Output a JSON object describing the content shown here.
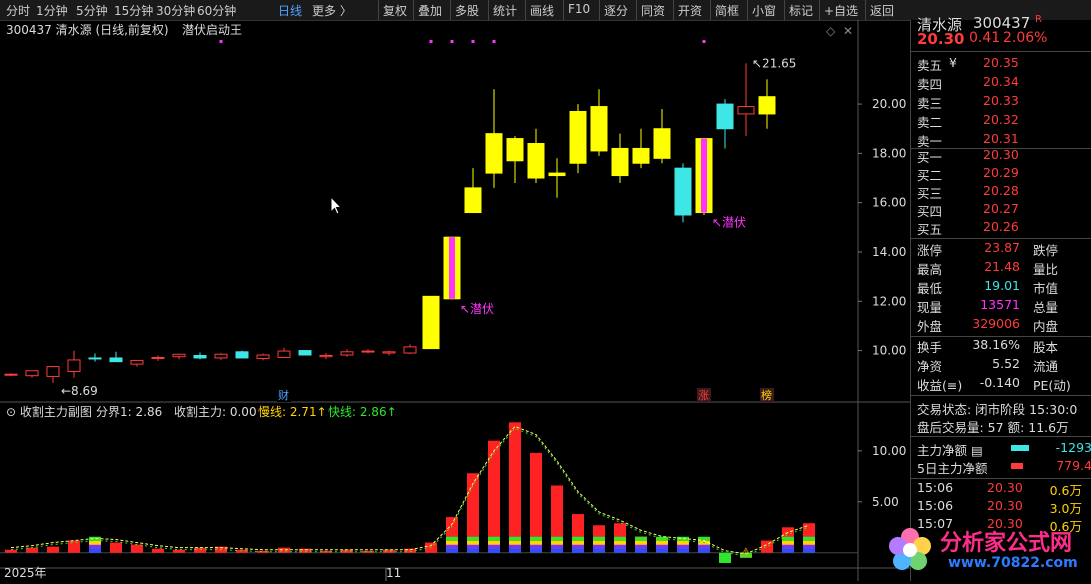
{
  "toolbar": {
    "period_items": [
      "分时",
      "1分钟",
      "5分钟",
      "15分钟",
      "30分钟",
      "60分钟",
      "日线",
      "更多 〉"
    ],
    "active_period": "日线",
    "buttons": [
      "复权",
      "叠加",
      "多股",
      "统计",
      "画线",
      "F10",
      "逐分",
      "同资",
      "开资",
      "简框",
      "小窗",
      "标记",
      "+自选",
      "返回"
    ]
  },
  "chart_header": {
    "code_name": "300437  清水源 (日线,前复权)",
    "indicator_name": "潜伏启动王"
  },
  "chart_data": [
    {
      "type": "candlestick",
      "title": "300437 清水源 (日线,前复权)",
      "indicator": "潜伏启动王",
      "y_ticks": [
        "20.00",
        "18.00",
        "16.00",
        "14.00",
        "12.00",
        "10.00"
      ],
      "ylim": [
        8.4,
        22.6
      ],
      "candles": [
        {
          "o": 9.0,
          "h": 9.08,
          "l": 8.96,
          "c": 9.04
        },
        {
          "o": 8.98,
          "h": 9.1,
          "l": 8.9,
          "c": 9.18
        },
        {
          "o": 8.95,
          "h": 9.3,
          "l": 8.69,
          "c": 9.35
        },
        {
          "o": 9.15,
          "h": 10.0,
          "l": 8.9,
          "c": 9.62
        },
        {
          "o": 9.7,
          "h": 9.88,
          "l": 9.55,
          "c": 9.68
        },
        {
          "o": 9.7,
          "h": 9.95,
          "l": 9.55,
          "c": 9.55
        },
        {
          "o": 9.45,
          "h": 9.58,
          "l": 9.35,
          "c": 9.6
        },
        {
          "o": 9.68,
          "h": 9.8,
          "l": 9.58,
          "c": 9.72
        },
        {
          "o": 9.75,
          "h": 9.85,
          "l": 9.65,
          "c": 9.85
        },
        {
          "o": 9.8,
          "h": 9.92,
          "l": 9.65,
          "c": 9.7
        },
        {
          "o": 9.7,
          "h": 9.9,
          "l": 9.62,
          "c": 9.85
        },
        {
          "o": 9.95,
          "h": 10.0,
          "l": 9.7,
          "c": 9.7
        },
        {
          "o": 9.68,
          "h": 9.88,
          "l": 9.6,
          "c": 9.82
        },
        {
          "o": 9.72,
          "h": 10.12,
          "l": 9.7,
          "c": 9.98
        },
        {
          "o": 10.0,
          "h": 10.02,
          "l": 9.8,
          "c": 9.82
        },
        {
          "o": 9.75,
          "h": 9.9,
          "l": 9.65,
          "c": 9.8
        },
        {
          "o": 9.82,
          "h": 10.05,
          "l": 9.75,
          "c": 9.95
        },
        {
          "o": 9.95,
          "h": 10.05,
          "l": 9.88,
          "c": 9.98
        },
        {
          "o": 9.9,
          "h": 10.0,
          "l": 9.8,
          "c": 9.95
        },
        {
          "o": 9.9,
          "h": 10.25,
          "l": 9.85,
          "c": 10.15
        },
        {
          "o": 10.08,
          "h": 12.2,
          "l": 10.08,
          "c": 12.2
        },
        {
          "o": 12.1,
          "h": 14.6,
          "l": 12.08,
          "c": 14.6
        },
        {
          "o": 15.6,
          "h": 17.4,
          "l": 15.6,
          "c": 16.6
        },
        {
          "o": 17.2,
          "h": 20.6,
          "l": 16.6,
          "c": 18.8
        },
        {
          "o": 17.7,
          "h": 18.7,
          "l": 16.8,
          "c": 18.6
        },
        {
          "o": 18.4,
          "h": 19.0,
          "l": 16.8,
          "c": 17.0
        },
        {
          "o": 17.2,
          "h": 17.8,
          "l": 16.2,
          "c": 17.1
        },
        {
          "o": 17.6,
          "h": 20.0,
          "l": 17.2,
          "c": 19.7
        },
        {
          "o": 18.1,
          "h": 20.6,
          "l": 17.9,
          "c": 19.9
        },
        {
          "o": 17.1,
          "h": 18.8,
          "l": 16.8,
          "c": 18.2
        },
        {
          "o": 17.6,
          "h": 19.0,
          "l": 17.4,
          "c": 18.2
        },
        {
          "o": 19.0,
          "h": 19.8,
          "l": 17.6,
          "c": 17.8
        },
        {
          "o": 17.4,
          "h": 17.6,
          "l": 15.2,
          "c": 15.5
        },
        {
          "o": 15.6,
          "h": 18.6,
          "l": 15.5,
          "c": 18.6
        },
        {
          "o": 19.0,
          "h": 20.2,
          "l": 18.2,
          "c": 20.0
        },
        {
          "o": 19.6,
          "h": 21.65,
          "l": 18.7,
          "c": 19.9
        },
        {
          "o": 19.6,
          "h": 21.0,
          "l": 19.0,
          "c": 20.3
        }
      ],
      "marker_candles": [
        21,
        33
      ],
      "marker_label": "潜伏",
      "low_label": "←8.69",
      "high_label": "21.65",
      "bottom_badges": [
        "财",
        "涨",
        "榜"
      ],
      "dots_at": [
        10,
        20,
        21,
        22,
        23,
        33
      ]
    },
    {
      "type": "bar",
      "title": "收割主力副图",
      "legend": [
        {
          "label": "分界1: 2.86",
          "color": "#dcdcdc"
        },
        {
          "label": "收割主力: 0.00",
          "color": "#dcdcdc"
        },
        {
          "label": "慢线: 2.71",
          "color": "#ffd400"
        },
        {
          "label": "快线: 2.86",
          "color": "#2ee62e"
        }
      ],
      "y_ticks": [
        "10.00",
        "5.00"
      ],
      "ylim": [
        -1.2,
        14.5
      ],
      "bars": [
        0.3,
        0.5,
        0.6,
        1.2,
        1.3,
        1.0,
        0.8,
        0.4,
        0.3,
        0.5,
        0.6,
        0.3,
        0.2,
        0.5,
        0.4,
        0.2,
        0.3,
        0.2,
        0.3,
        0.4,
        1.0,
        3.5,
        7.8,
        11.0,
        12.8,
        9.8,
        6.6,
        3.8,
        2.7,
        2.9,
        1.6,
        1.5,
        1.5,
        1.5,
        -1.0,
        -0.5,
        1.2,
        2.5,
        2.9
      ],
      "slow_line": [
        0.5,
        0.7,
        1.0,
        1.2,
        1.4,
        1.3,
        1.0,
        0.7,
        0.5,
        0.5,
        0.5,
        0.4,
        0.3,
        0.3,
        0.3,
        0.3,
        0.3,
        0.3,
        0.3,
        0.3,
        0.7,
        2.8,
        6.8,
        10.0,
        12.4,
        11.6,
        9.0,
        6.0,
        4.0,
        3.2,
        2.2,
        1.6,
        1.4,
        1.2,
        0.2,
        -0.1,
        0.8,
        2.0,
        2.7
      ],
      "x_labels": [
        "2025年",
        "11"
      ]
    }
  ],
  "quote_panel": {
    "name": "清水源",
    "code": "300437",
    "r_badge": "R",
    "price": "20.30",
    "change": "0.41",
    "pct": "2.06%",
    "asks": [
      {
        "label": "卖五",
        "price": "20.35",
        "mark": "¥"
      },
      {
        "label": "卖四",
        "price": "20.34",
        "mark": ""
      },
      {
        "label": "卖三",
        "price": "20.33",
        "mark": ""
      },
      {
        "label": "卖二",
        "price": "20.32",
        "mark": ""
      },
      {
        "label": "卖一",
        "price": "20.31",
        "mark": ""
      }
    ],
    "bids": [
      {
        "label": "买一",
        "price": "20.30"
      },
      {
        "label": "买二",
        "price": "20.29"
      },
      {
        "label": "买三",
        "price": "20.28"
      },
      {
        "label": "买四",
        "price": "20.27"
      },
      {
        "label": "买五",
        "price": "20.26"
      }
    ],
    "stats1": [
      {
        "l": "涨停",
        "v": "23.87",
        "cls": "r",
        "l2": "跌停"
      },
      {
        "l": "最高",
        "v": "21.48",
        "cls": "r",
        "l2": "量比"
      },
      {
        "l": "最低",
        "v": "19.01",
        "cls": "c",
        "l2": "市值"
      },
      {
        "l": "现量",
        "v": "13571",
        "cls": "m",
        "l2": "总量"
      },
      {
        "l": "外盘",
        "v": "329006",
        "cls": "r",
        "l2": "内盘"
      }
    ],
    "stats2": [
      {
        "l": "换手",
        "v": "38.16%",
        "l2": "股本"
      },
      {
        "l": "净资",
        "v": "5.52",
        "l2": "流通"
      },
      {
        "l": "收益(≡)",
        "v": "-0.140",
        "l2": "PE(动)"
      }
    ],
    "trade_state": "交易状态: 闭市阶段 15:30:0",
    "after_hours": "盘后交易量: 57  额: 11.6万",
    "main_net_label": "主力净额",
    "main_net_value": "-1293",
    "main5_label": "5日主力净额",
    "main5_value": "779.4",
    "ticks": [
      {
        "t": "15:06",
        "p": "20.30",
        "a": "0.6万"
      },
      {
        "t": "15:06",
        "p": "20.30",
        "a": "3.0万"
      },
      {
        "t": "15:07",
        "p": "20.30",
        "a": "0.6万"
      }
    ]
  },
  "watermark": {
    "text": "分析家公式网",
    "url": "www.70822.com"
  },
  "colors": {
    "up": "#ff3b3b",
    "down": "#3ee6e6",
    "yellow": "#ffff00",
    "magenta": "#ff33ff"
  }
}
